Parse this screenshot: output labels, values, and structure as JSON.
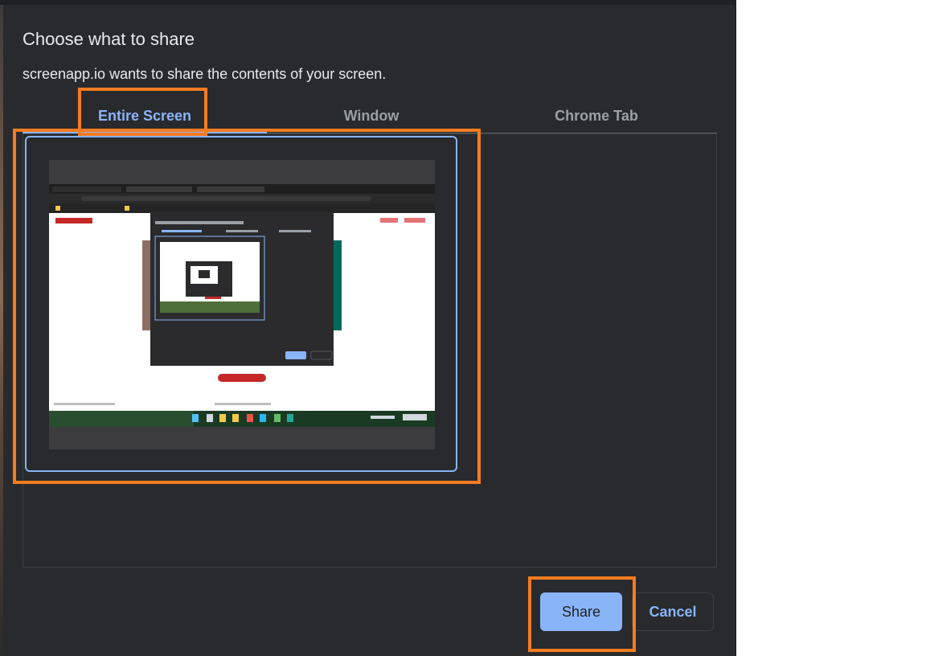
{
  "dialog": {
    "title": "Choose what to share",
    "subtitle": "screenapp.io wants to share the contents of your screen."
  },
  "tabs": [
    {
      "label": "Entire Screen",
      "active": true
    },
    {
      "label": "Window",
      "active": false
    },
    {
      "label": "Chrome Tab",
      "active": false
    }
  ],
  "buttons": {
    "share": "Share",
    "cancel": "Cancel"
  },
  "colors": {
    "dialog_bg": "#292a2d",
    "accent": "#8ab4f8",
    "highlight": "#f57c21",
    "text": "#e8eaed",
    "muted": "#9aa0a6"
  },
  "icons": {
    "screen_thumbnail": "desktop-screenshot-thumbnail"
  }
}
